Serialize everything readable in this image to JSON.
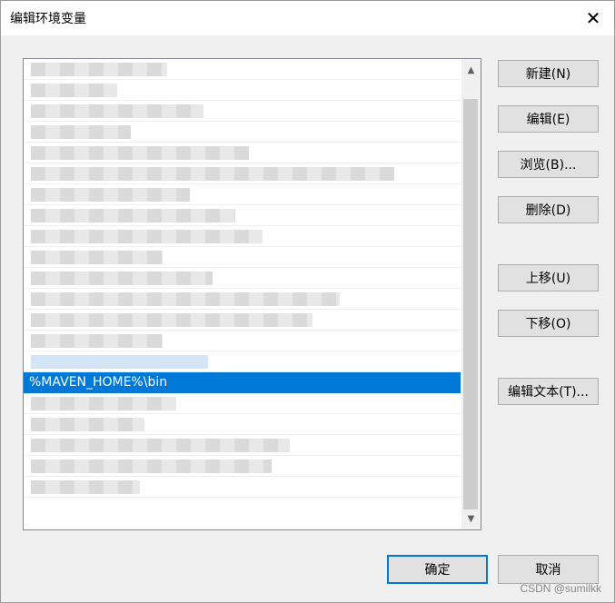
{
  "window": {
    "title": "编辑环境变量",
    "close_glyph": "✕"
  },
  "list": {
    "selected_entry": "%MAVEN_HOME%\\bin",
    "scroll_up_glyph": "▲",
    "scroll_down_glyph": "▼"
  },
  "buttons": {
    "new": "新建(N)",
    "edit": "编辑(E)",
    "browse": "浏览(B)...",
    "delete": "删除(D)",
    "move_up": "上移(U)",
    "move_down": "下移(O)",
    "edit_text": "编辑文本(T)...",
    "ok": "确定",
    "cancel": "取消"
  },
  "watermark": "CSDN @sumilkk",
  "colors": {
    "selection": "#0078d7",
    "dialog_bg": "#f0f0f0",
    "button_bg": "#e1e1e1"
  }
}
